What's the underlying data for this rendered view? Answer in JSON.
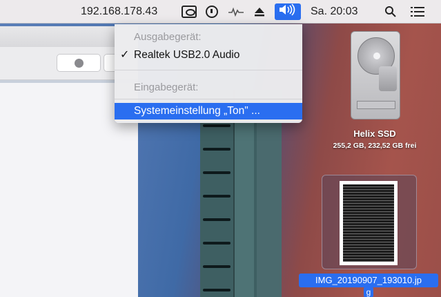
{
  "menubar": {
    "ip": "192.168.178.43",
    "time": "Sa. 20:03",
    "icons": [
      "display-icon",
      "clock-icon",
      "activity-icon",
      "eject-icon",
      "volume-icon",
      "search-icon",
      "list-icon"
    ]
  },
  "menu": {
    "output_header": "Ausgabegerät:",
    "output_device": "Realtek USB2.0 Audio",
    "input_header": "Eingabegerät:",
    "settings_item": "Systemeinstellung „Ton\" ..."
  },
  "desktop": {
    "drive_name": "Helix SSD",
    "drive_info": "255,2 GB, 232,52 GB frei",
    "image_name": "IMG_20190907_193010.jp",
    "image_name_cont": "g"
  },
  "colors": {
    "accent": "#2a6ef0"
  }
}
